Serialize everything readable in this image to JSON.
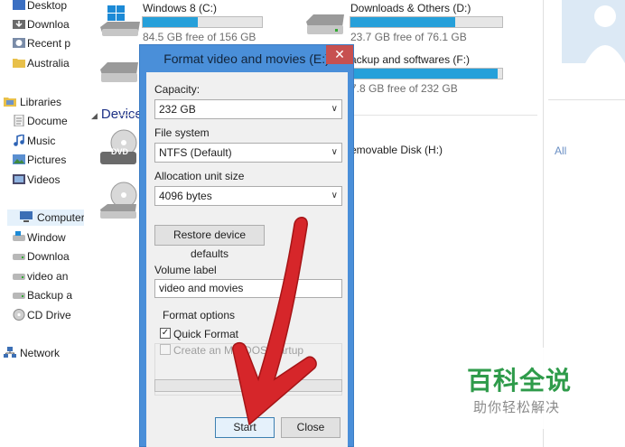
{
  "nav": {
    "items": [
      {
        "label": "Desktop",
        "icon": "desktop-icon"
      },
      {
        "label": "Downloa",
        "icon": "downloads-folder-icon"
      },
      {
        "label": "Recent p",
        "icon": "recent-places-icon"
      },
      {
        "label": "Australia",
        "icon": "folder-icon"
      },
      {
        "label": "Libraries",
        "icon": "libraries-icon"
      },
      {
        "label": "Docume",
        "icon": "documents-icon"
      },
      {
        "label": "Music",
        "icon": "music-icon"
      },
      {
        "label": "Pictures",
        "icon": "pictures-icon"
      },
      {
        "label": "Videos",
        "icon": "videos-icon"
      },
      {
        "label": "Computer",
        "icon": "computer-icon"
      },
      {
        "label": "Window",
        "icon": "drive-icon"
      },
      {
        "label": "Downloa",
        "icon": "drive-icon"
      },
      {
        "label": "video an",
        "icon": "drive-icon"
      },
      {
        "label": "Backup a",
        "icon": "drive-icon"
      },
      {
        "label": "CD Drive",
        "icon": "cd-drive-icon"
      },
      {
        "label": "Network",
        "icon": "network-icon"
      }
    ]
  },
  "main": {
    "devices_header": "Device",
    "drives": [
      {
        "name": "Windows 8 (C:)",
        "free": "84.5 GB free of 156 GB",
        "used_fraction": 0.46
      },
      {
        "name": "Downloads & Others (D:)",
        "free": "23.7 GB free of 76.1 GB",
        "used_fraction": 0.69
      },
      {
        "name": "ackup and softwares (F:)",
        "free": "7.8 GB free of 232 GB",
        "used_fraction": 0.97
      },
      {
        "name": "emovable Disk (H:)"
      }
    ],
    "dvd_badge": "DVD",
    "right_link": "All"
  },
  "dialog": {
    "title": "Format video and movies (E:)",
    "close_glyph": "✕",
    "capacity_label": "Capacity:",
    "capacity_value": "232 GB",
    "filesystem_label": "File system",
    "filesystem_value": "NTFS (Default)",
    "alloc_label": "Allocation unit size",
    "alloc_value": "4096 bytes",
    "restore_button": "Restore device defaults",
    "volume_label": "Volume label",
    "volume_value": "video and movies",
    "format_options_label": "Format options",
    "quick_format_label": "Quick Format",
    "quick_format_checked": true,
    "msdos_label": "Create an MS-DOS startup",
    "msdos_checked": false,
    "start_button": "Start",
    "close_button": "Close",
    "chevron": "∨",
    "check_glyph": "✓"
  },
  "watermark": {
    "title": "百科全说",
    "subtitle": "助你轻松解决"
  },
  "colors": {
    "dialog_frame": "#4a8fd9",
    "close_red": "#c75050",
    "drive_bar": "#26a0da",
    "arrow_red": "#d6262a",
    "watermark_green": "#2e9b4a"
  }
}
